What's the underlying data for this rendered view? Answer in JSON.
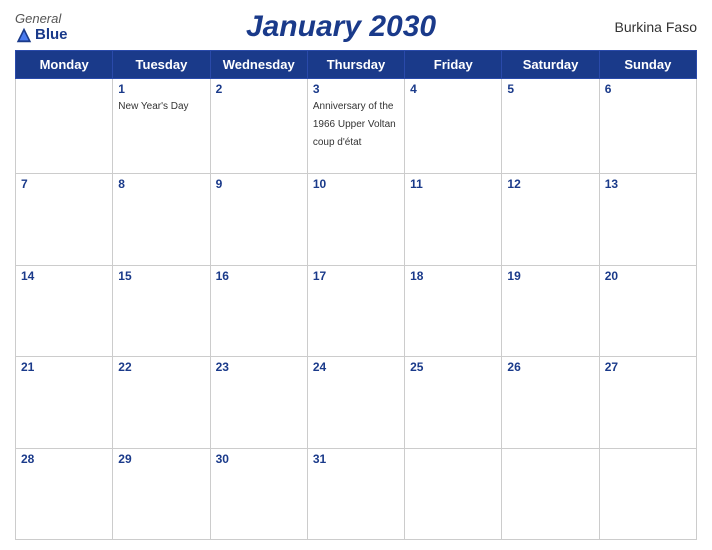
{
  "header": {
    "logo_general": "General",
    "logo_blue": "Blue",
    "title": "January 2030",
    "country": "Burkina Faso"
  },
  "days_of_week": [
    "Monday",
    "Tuesday",
    "Wednesday",
    "Thursday",
    "Friday",
    "Saturday",
    "Sunday"
  ],
  "weeks": [
    [
      {
        "day": "",
        "empty": true
      },
      {
        "day": "1",
        "event": "New Year's Day"
      },
      {
        "day": "2",
        "event": ""
      },
      {
        "day": "3",
        "event": "Anniversary of the 1966 Upper Voltan coup d'état"
      },
      {
        "day": "4",
        "event": ""
      },
      {
        "day": "5",
        "event": ""
      },
      {
        "day": "6",
        "event": ""
      }
    ],
    [
      {
        "day": "7",
        "event": ""
      },
      {
        "day": "8",
        "event": ""
      },
      {
        "day": "9",
        "event": ""
      },
      {
        "day": "10",
        "event": ""
      },
      {
        "day": "11",
        "event": ""
      },
      {
        "day": "12",
        "event": ""
      },
      {
        "day": "13",
        "event": ""
      }
    ],
    [
      {
        "day": "14",
        "event": ""
      },
      {
        "day": "15",
        "event": ""
      },
      {
        "day": "16",
        "event": ""
      },
      {
        "day": "17",
        "event": ""
      },
      {
        "day": "18",
        "event": ""
      },
      {
        "day": "19",
        "event": ""
      },
      {
        "day": "20",
        "event": ""
      }
    ],
    [
      {
        "day": "21",
        "event": ""
      },
      {
        "day": "22",
        "event": ""
      },
      {
        "day": "23",
        "event": ""
      },
      {
        "day": "24",
        "event": ""
      },
      {
        "day": "25",
        "event": ""
      },
      {
        "day": "26",
        "event": ""
      },
      {
        "day": "27",
        "event": ""
      }
    ],
    [
      {
        "day": "28",
        "event": ""
      },
      {
        "day": "29",
        "event": ""
      },
      {
        "day": "30",
        "event": ""
      },
      {
        "day": "31",
        "event": ""
      },
      {
        "day": "",
        "empty": true
      },
      {
        "day": "",
        "empty": true
      },
      {
        "day": "",
        "empty": true
      }
    ]
  ]
}
